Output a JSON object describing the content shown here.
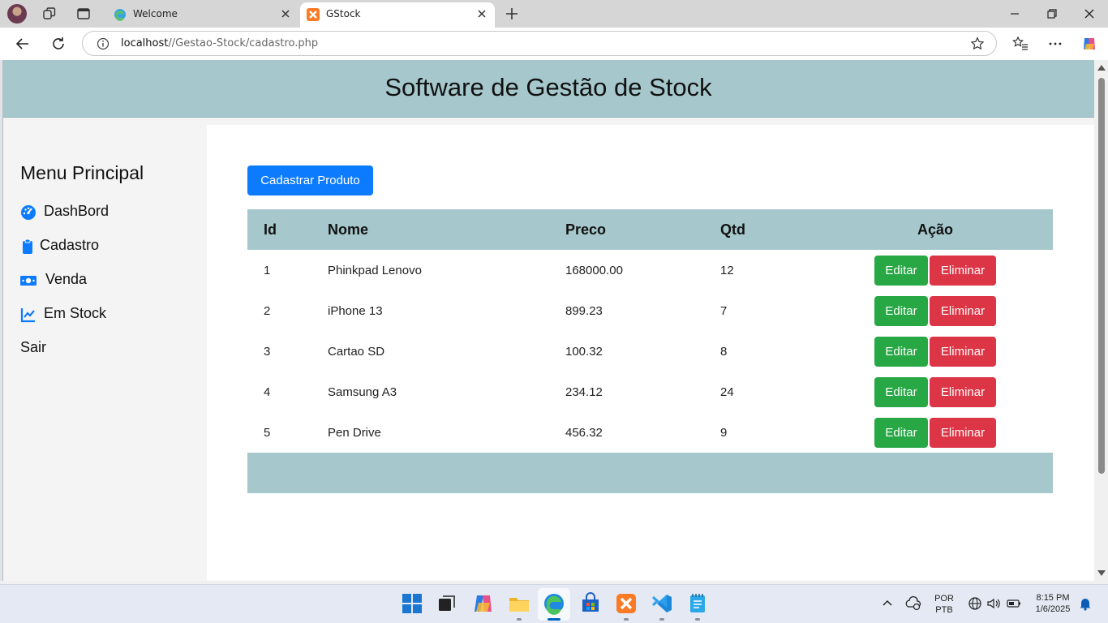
{
  "browser": {
    "tabs": [
      {
        "title": "Welcome",
        "active": false,
        "favicon": "edge-icon"
      },
      {
        "title": "GStock",
        "active": true,
        "favicon": "xampp-icon"
      }
    ],
    "url_host": "localhost",
    "url_path": "//Gestao-Stock/cadastro.php"
  },
  "page": {
    "header_title": "Software de Gestão de Stock",
    "sidebar": {
      "title": "Menu Principal",
      "items": [
        {
          "label": "DashBord",
          "icon": "dashboard-icon"
        },
        {
          "label": "Cadastro",
          "icon": "clipboard-icon"
        },
        {
          "label": "Venda",
          "icon": "money-icon"
        },
        {
          "label": "Em Stock",
          "icon": "chart-line-icon"
        },
        {
          "label": "Sair",
          "icon": ""
        }
      ]
    },
    "register_button": "Cadastrar Produto",
    "table": {
      "headers": [
        "Id",
        "Nome",
        "Preco",
        "Qtd",
        "Ação"
      ],
      "rows": [
        {
          "id": "1",
          "nome": "Phinkpad Lenovo",
          "preco": "168000.00",
          "qtd": "12"
        },
        {
          "id": "2",
          "nome": "iPhone 13",
          "preco": "899.23",
          "qtd": "7"
        },
        {
          "id": "3",
          "nome": "Cartao SD",
          "preco": "100.32",
          "qtd": "8"
        },
        {
          "id": "4",
          "nome": "Samsung A3",
          "preco": "234.12",
          "qtd": "24"
        },
        {
          "id": "5",
          "nome": "Pen Drive",
          "preco": "456.32",
          "qtd": "9"
        }
      ],
      "edit_label": "Editar",
      "delete_label": "Eliminar"
    }
  },
  "taskbar": {
    "language": "POR",
    "layout": "PTB",
    "time": "8:15 PM",
    "date": "1/6/2025"
  },
  "colors": {
    "header_bg": "#a6c8cd",
    "primary": "#0d7bfd",
    "success": "#28a745",
    "danger": "#dc3545"
  }
}
